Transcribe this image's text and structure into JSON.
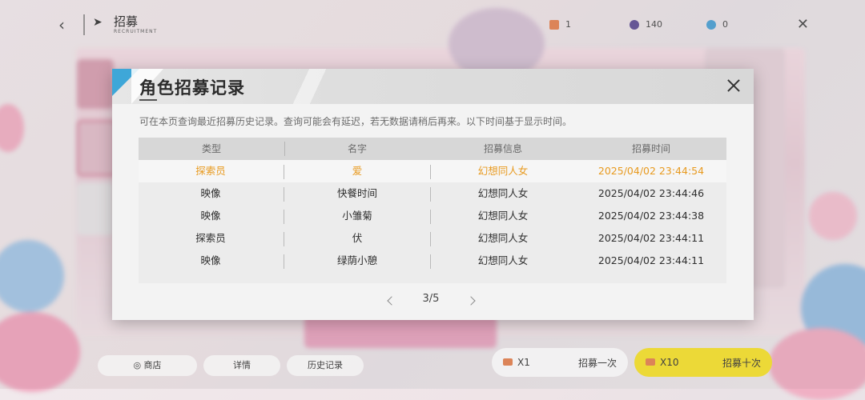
{
  "colors": {
    "accent_blue": "#3ea7d8",
    "highlight_gold": "#e89a1f",
    "recruit_ten_yellow": "#f6e23a"
  },
  "background": {
    "page_title": "招募",
    "page_subtitle": "RECRUITMENT",
    "resources": [
      {
        "icon": "ticket-icon",
        "value": "1"
      },
      {
        "icon": "crystal-icon",
        "value": "140"
      },
      {
        "icon": "gem-icon",
        "value": "0"
      }
    ],
    "bottom_buttons": {
      "shop": "商店",
      "details": "详情",
      "history": "历史记录"
    },
    "recruit_once": {
      "count": "X1",
      "label": "招募一次"
    },
    "recruit_ten": {
      "count": "X10",
      "label": "招募十次"
    }
  },
  "modal": {
    "title": "角色招募记录",
    "note": "可在本页查询最近招募历史记录。查询可能会有延迟，若无数据请稍后再来。以下时间基于显示时间。",
    "columns": [
      "类型",
      "名字",
      "招募信息",
      "招募时间"
    ],
    "rows": [
      {
        "type": "探索员",
        "name": "爱",
        "info": "幻想同人女",
        "time": "2025/04/02 23:44:54"
      },
      {
        "type": "映像",
        "name": "快餐时间",
        "info": "幻想同人女",
        "time": "2025/04/02 23:44:46"
      },
      {
        "type": "映像",
        "name": "小雏菊",
        "info": "幻想同人女",
        "time": "2025/04/02 23:44:38"
      },
      {
        "type": "探索员",
        "name": "伏",
        "info": "幻想同人女",
        "time": "2025/04/02 23:44:11"
      },
      {
        "type": "映像",
        "name": "绿荫小憩",
        "info": "幻想同人女",
        "time": "2025/04/02 23:44:11"
      }
    ],
    "pager": {
      "text": "3/5"
    }
  }
}
